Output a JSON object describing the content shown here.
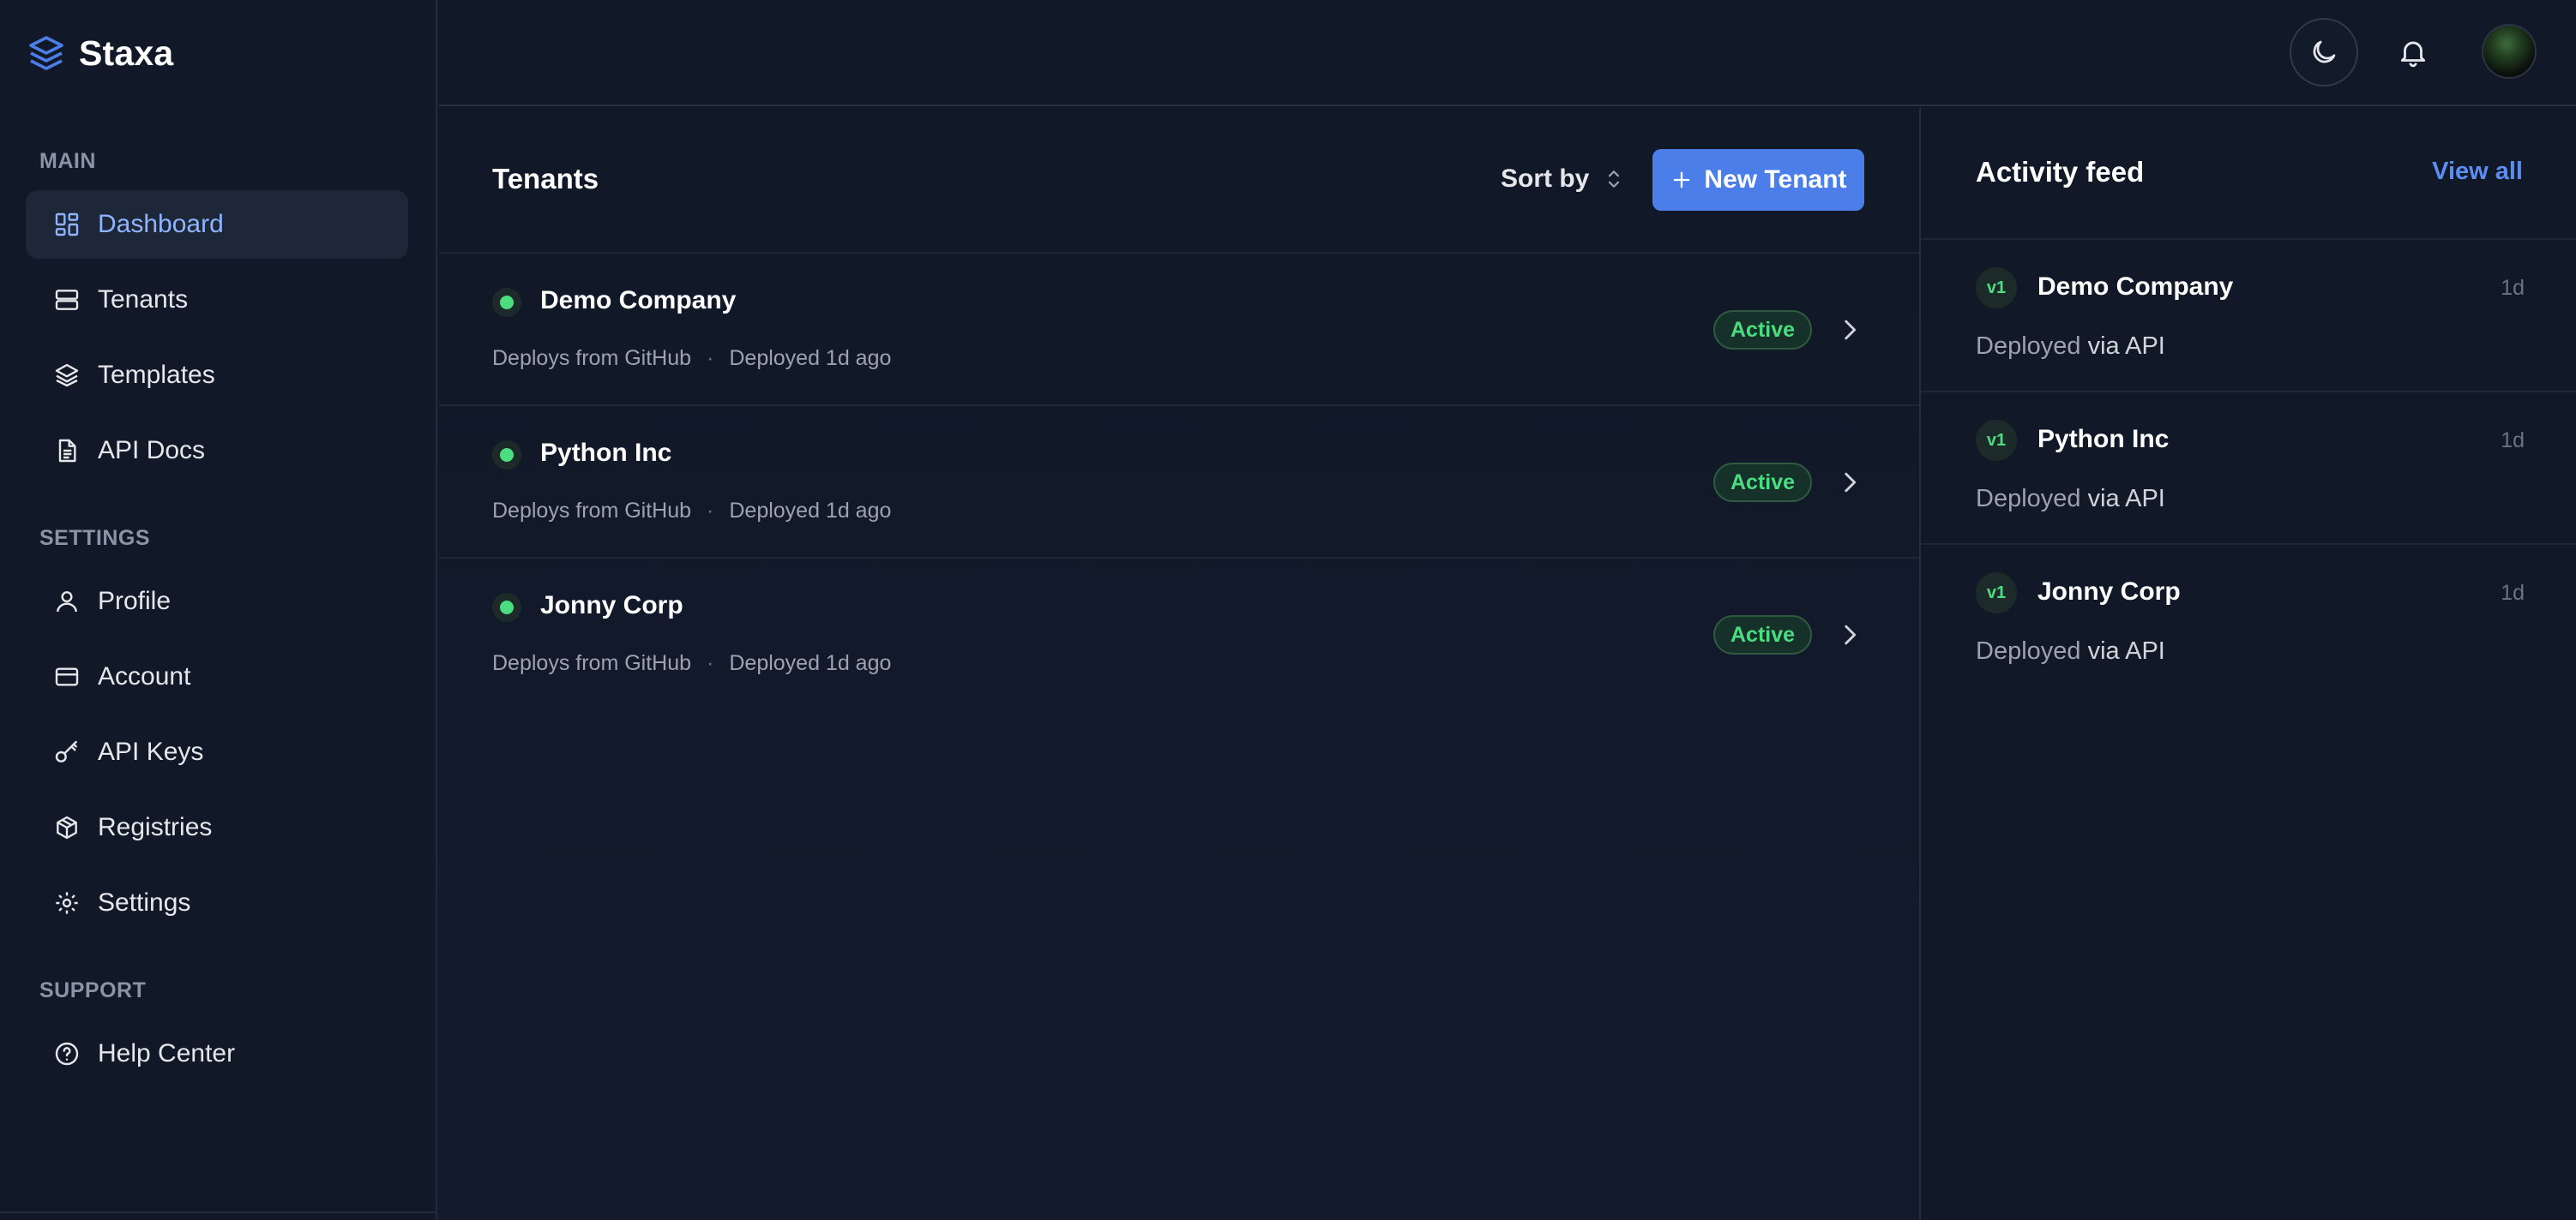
{
  "app": {
    "name": "Staxa"
  },
  "sidebar": {
    "sections": [
      {
        "title": "MAIN",
        "items": [
          {
            "label": "Dashboard",
            "icon": "dashboard-icon",
            "active": true
          },
          {
            "label": "Tenants",
            "icon": "server-icon"
          },
          {
            "label": "Templates",
            "icon": "layers-icon"
          },
          {
            "label": "API Docs",
            "icon": "document-icon"
          }
        ]
      },
      {
        "title": "SETTINGS",
        "items": [
          {
            "label": "Profile",
            "icon": "user-icon"
          },
          {
            "label": "Account",
            "icon": "credit-card-icon"
          },
          {
            "label": "API Keys",
            "icon": "key-icon"
          },
          {
            "label": "Registries",
            "icon": "package-icon"
          },
          {
            "label": "Settings",
            "icon": "gear-icon"
          }
        ]
      },
      {
        "title": "SUPPORT",
        "items": [
          {
            "label": "Help Center",
            "icon": "help-circle-icon"
          }
        ]
      }
    ]
  },
  "tenants": {
    "title": "Tenants",
    "sort_label": "Sort by",
    "new_button": "New Tenant",
    "rows": [
      {
        "name": "Demo Company",
        "source": "Deploys from GitHub",
        "deployed": "Deployed 1d ago",
        "status": "Active"
      },
      {
        "name": "Python Inc",
        "source": "Deploys from GitHub",
        "deployed": "Deployed 1d ago",
        "status": "Active"
      },
      {
        "name": "Jonny Corp",
        "source": "Deploys from GitHub",
        "deployed": "Deployed 1d ago",
        "status": "Active"
      }
    ]
  },
  "activity": {
    "title": "Activity feed",
    "view_all": "View all",
    "items": [
      {
        "version": "v1",
        "name": "Demo Company",
        "time": "1d",
        "action": "Deployed",
        "via": "via API"
      },
      {
        "version": "v1",
        "name": "Python Inc",
        "time": "1d",
        "action": "Deployed",
        "via": "via API"
      },
      {
        "version": "v1",
        "name": "Jonny Corp",
        "time": "1d",
        "action": "Deployed",
        "via": "via API"
      }
    ]
  },
  "colors": {
    "accent": "#4b7ee8",
    "active_nav": "#8db4ff",
    "status_green": "#4ade80",
    "background": "#111827"
  }
}
